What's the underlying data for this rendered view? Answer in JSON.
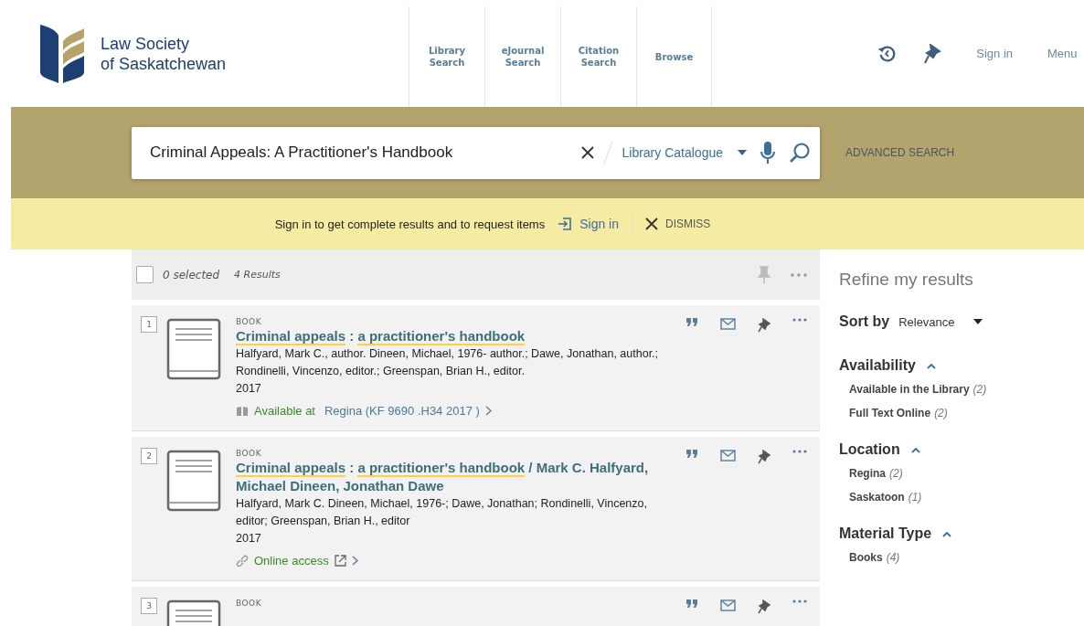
{
  "logo": {
    "line1": "Law Society",
    "line2": "of Saskatchewan"
  },
  "nav": [
    {
      "label": "Library Search"
    },
    {
      "label": "eJournal Search"
    },
    {
      "label": "Citation Search"
    },
    {
      "label": "Browse"
    }
  ],
  "header_right": {
    "sign_in": "Sign in",
    "menu": "Menu"
  },
  "search": {
    "value": "Criminal Appeals: A Practitioner's Handbook",
    "scope": "Library Catalogue",
    "advanced": "ADVANCED SEARCH"
  },
  "notice": {
    "text": "Sign in to get complete results and to request items",
    "sign_in": "Sign in",
    "dismiss": "DISMISS"
  },
  "results_bar": {
    "selected": "0 selected",
    "count": "4 Results",
    "checked": false
  },
  "results": [
    {
      "number": "1",
      "type": "BOOK",
      "title": [
        {
          "text": "Criminal appeals",
          "highlighted": true
        },
        {
          "text": " : ",
          "highlighted": false
        },
        {
          "text": "a practitioner's handbook",
          "highlighted": true
        }
      ],
      "authors": "Halfyard, Mark C., author. Dineen, Michael, 1976- author.; Dawe, Jonathan, author.; Rondinelli, Vincenzo, editor.; Greenspan, Brian H., editor.",
      "year": "2017",
      "access": {
        "kind": "location",
        "status": "Available at",
        "detail": "Regina (KF 9690 .H34 2017 )"
      }
    },
    {
      "number": "2",
      "type": "BOOK",
      "title": [
        {
          "text": "Criminal appeals",
          "highlighted": true
        },
        {
          "text": " : ",
          "highlighted": false
        },
        {
          "text": "a practitioner's handbook",
          "highlighted": true
        },
        {
          "text": " / Mark C. Halfyard, Michael Dineen, Jonathan Dawe",
          "highlighted": false
        }
      ],
      "authors": "Halfyard, Mark C. Dineen, Michael, 1976-; Dawe, Jonathan; Rondinelli, Vincenzo, editor; Greenspan, Brian H., editor",
      "year": "2017",
      "access": {
        "kind": "online",
        "status": "Online access"
      }
    },
    {
      "number": "3",
      "type": "BOOK"
    }
  ],
  "sidebar": {
    "title": "Refine my results",
    "sort_label": "Sort by",
    "sort_value": "Relevance",
    "facets": [
      {
        "name": "Availability",
        "expanded": true,
        "items": [
          {
            "label": "Available in the Library",
            "count": "(2)"
          },
          {
            "label": "Full Text Online",
            "count": "(2)"
          }
        ]
      },
      {
        "name": "Location",
        "expanded": true,
        "items": [
          {
            "label": "Regina",
            "count": "(2)"
          },
          {
            "label": "Saskatoon",
            "count": "(1)"
          }
        ]
      },
      {
        "name": "Material Type",
        "expanded": true,
        "items": [
          {
            "label": "Books",
            "count": "(4)"
          }
        ]
      }
    ]
  }
}
